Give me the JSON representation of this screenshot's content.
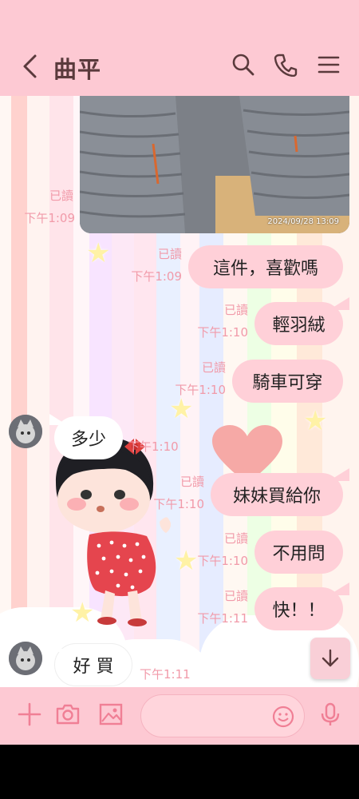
{
  "header": {
    "title": "曲平",
    "icons": [
      "back-icon",
      "search-icon",
      "phone-icon",
      "menu-icon"
    ]
  },
  "photo": {
    "timestamp": "2024/09/28 13:09",
    "read_label": "已讀",
    "time": "下午1:09"
  },
  "messages": [
    {
      "side": "out",
      "text": "這件，喜歡嗎",
      "read": "已讀",
      "time": "下午1:09"
    },
    {
      "side": "out",
      "text": "輕羽絨",
      "read": "已讀",
      "time": "下午1:10"
    },
    {
      "side": "out",
      "text": "騎車可穿",
      "read": "已讀",
      "time": "下午1:10"
    },
    {
      "side": "in",
      "text": "多少",
      "time": "下午1:10"
    },
    {
      "side": "out",
      "text": "妹妹買給你",
      "read": "已讀",
      "time": "下午1:10"
    },
    {
      "side": "out",
      "text": "不用問",
      "read": "已讀",
      "time": "下午1:10"
    },
    {
      "side": "out",
      "text": "快！！",
      "read": "已讀",
      "time": "下午1:11"
    },
    {
      "side": "in",
      "text": "好 買",
      "time": "下午1:11"
    }
  ],
  "footer": {
    "input_placeholder": "",
    "icons": [
      "plus-icon",
      "camera-icon",
      "image-icon",
      "emoji-icon",
      "mic-icon"
    ]
  },
  "colors": {
    "header_bg": "#fdc9d3",
    "outgoing_bubble": "#ffd0d8",
    "incoming_bubble": "#ffffff",
    "meta_text": "#f19aa9",
    "title_text": "#5a3a3c"
  }
}
